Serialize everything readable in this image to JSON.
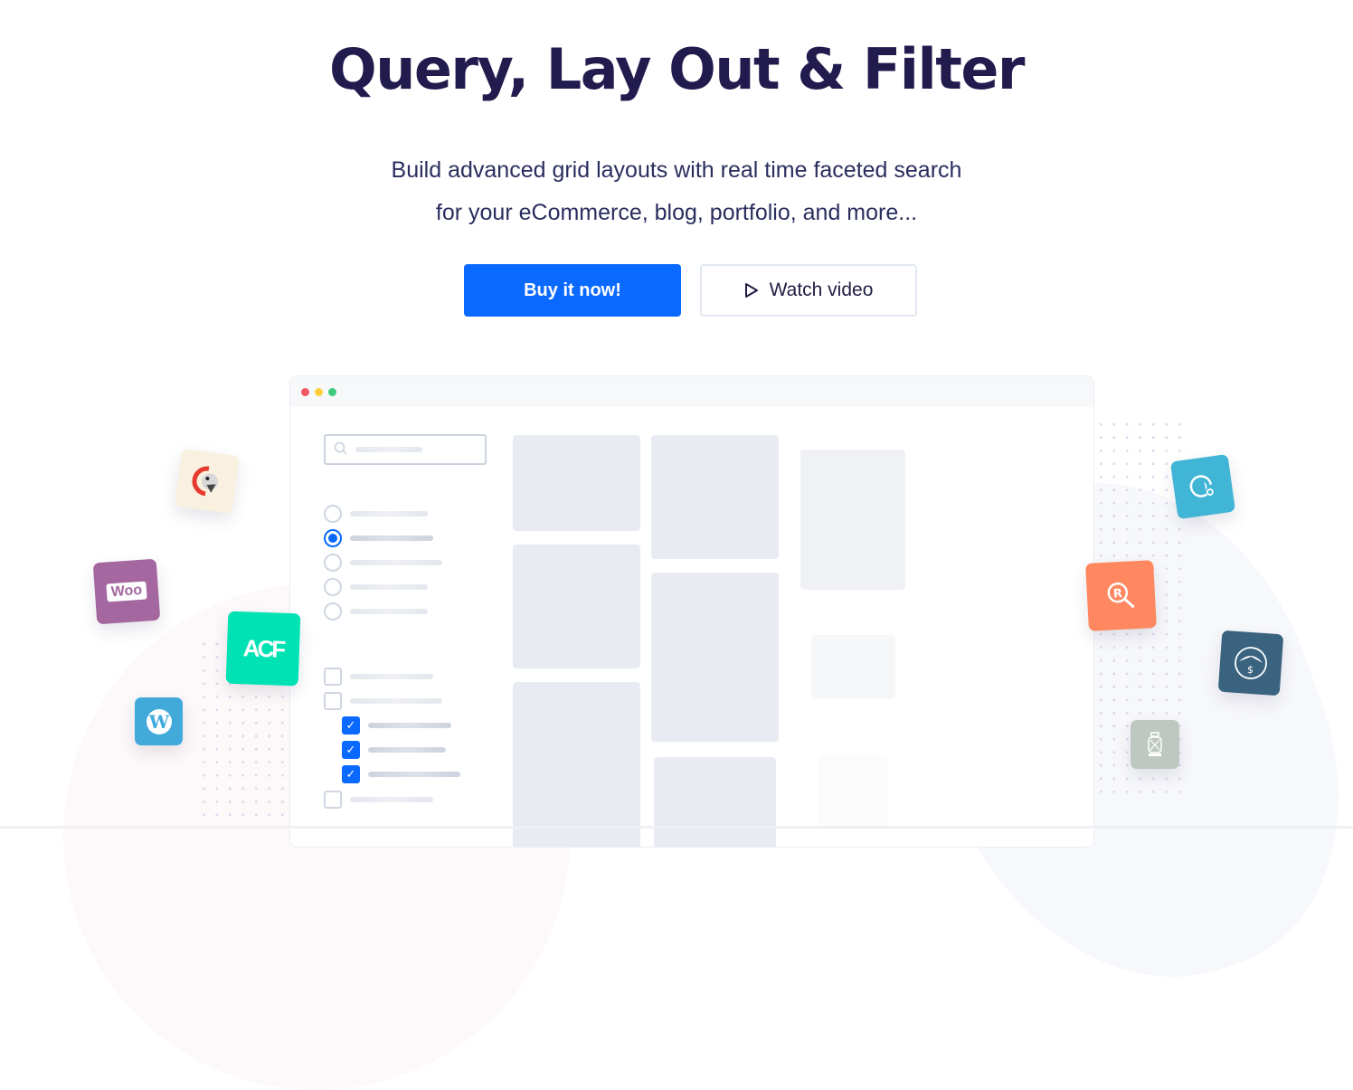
{
  "hero": {
    "title": "Query, Lay Out & Filter",
    "subtitle_line1": "Build advanced grid layouts with real time faceted search",
    "subtitle_line2": "for your eCommerce, blog, portfolio, and more..."
  },
  "buttons": {
    "buy_label": "Buy it now!",
    "watch_label": "Watch video",
    "watch_icon": "play-icon"
  },
  "colors": {
    "primary": "#0a69ff",
    "title": "#221c4e",
    "window_dot_red": "#f25563",
    "window_dot_yellow": "#fdce3b",
    "window_dot_green": "#3ecb7c"
  },
  "mockup": {
    "search_icon": "search-icon",
    "radio_options": [
      {
        "selected": false
      },
      {
        "selected": true
      },
      {
        "selected": false
      },
      {
        "selected": false
      },
      {
        "selected": false
      }
    ],
    "checkbox_options": [
      {
        "checked": false,
        "nested": false
      },
      {
        "checked": false,
        "nested": false
      },
      {
        "checked": true,
        "nested": true
      },
      {
        "checked": true,
        "nested": true
      },
      {
        "checked": true,
        "nested": true
      },
      {
        "checked": false,
        "nested": false
      }
    ]
  },
  "integration_logos": {
    "left": [
      {
        "name": "parrot-logo",
        "color": "#f9f0e0"
      },
      {
        "name": "woocommerce-logo",
        "text": "Woo",
        "color": "#a4679f"
      },
      {
        "name": "acf-logo",
        "text": "ACF",
        "color": "#00e2b4"
      },
      {
        "name": "wordpress-logo",
        "color": "#41aadb"
      }
    ],
    "right": [
      {
        "name": "chat-logo",
        "color": "#41b5d6"
      },
      {
        "name": "relevanssi-logo",
        "text": "R",
        "color": "#ff8860"
      },
      {
        "name": "dollar-logo",
        "text": "$",
        "color": "#3a637f"
      },
      {
        "name": "lantern-logo",
        "color": "#bec8c0"
      }
    ]
  }
}
